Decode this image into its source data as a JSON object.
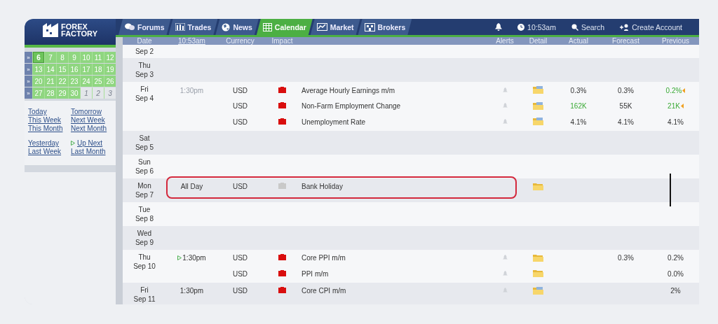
{
  "logo": {
    "line_1": "FOREX",
    "line_2": "FACTORY"
  },
  "nav": {
    "tabs": [
      {
        "label": "Forums",
        "selected": false
      },
      {
        "label": "Trades",
        "selected": false
      },
      {
        "label": "News",
        "selected": false
      },
      {
        "label": "Calendar",
        "selected": true
      },
      {
        "label": "Market",
        "selected": false
      },
      {
        "label": "Brokers",
        "selected": false
      }
    ],
    "time": "10:53am",
    "search": "Search",
    "create_account": "Create Account"
  },
  "mini_calendar": {
    "weeks": [
      [
        {
          "day": "6",
          "in_month": true,
          "selected": true
        },
        {
          "day": "7",
          "in_month": true,
          "selected": false
        },
        {
          "day": "8",
          "in_month": true,
          "selected": false
        },
        {
          "day": "9",
          "in_month": true,
          "selected": false
        },
        {
          "day": "10",
          "in_month": true,
          "selected": false
        },
        {
          "day": "11",
          "in_month": true,
          "selected": false
        },
        {
          "day": "12",
          "in_month": true,
          "selected": false
        }
      ],
      [
        {
          "day": "13",
          "in_month": true,
          "selected": false
        },
        {
          "day": "14",
          "in_month": true,
          "selected": false
        },
        {
          "day": "15",
          "in_month": true,
          "selected": false
        },
        {
          "day": "16",
          "in_month": true,
          "selected": false
        },
        {
          "day": "17",
          "in_month": true,
          "selected": false
        },
        {
          "day": "18",
          "in_month": true,
          "selected": false
        },
        {
          "day": "19",
          "in_month": true,
          "selected": false
        }
      ],
      [
        {
          "day": "20",
          "in_month": true,
          "selected": false
        },
        {
          "day": "21",
          "in_month": true,
          "selected": false
        },
        {
          "day": "22",
          "in_month": true,
          "selected": false
        },
        {
          "day": "23",
          "in_month": true,
          "selected": false
        },
        {
          "day": "24",
          "in_month": true,
          "selected": false
        },
        {
          "day": "25",
          "in_month": true,
          "selected": false
        },
        {
          "day": "26",
          "in_month": true,
          "selected": false
        }
      ],
      [
        {
          "day": "27",
          "in_month": true,
          "selected": false
        },
        {
          "day": "28",
          "in_month": true,
          "selected": false
        },
        {
          "day": "29",
          "in_month": true,
          "selected": false
        },
        {
          "day": "30",
          "in_month": true,
          "selected": false
        },
        {
          "day": "1",
          "in_month": false,
          "selected": false
        },
        {
          "day": "2",
          "in_month": false,
          "selected": false
        },
        {
          "day": "3",
          "in_month": false,
          "selected": false
        }
      ]
    ],
    "week_marker": "»"
  },
  "quick_links": [
    {
      "label": "Today",
      "marker": false
    },
    {
      "label": "Tomorrow",
      "marker": false
    },
    {
      "label": "This Week",
      "marker": false
    },
    {
      "label": "Next Week",
      "marker": false
    },
    {
      "label": "This Month",
      "marker": false
    },
    {
      "label": "Next Month",
      "marker": false
    },
    {
      "label": "Yesterday",
      "marker": false
    },
    {
      "label": "Up Next",
      "marker": true
    },
    {
      "label": "Last Week",
      "marker": false
    },
    {
      "label": "Last Month",
      "marker": false
    }
  ],
  "table": {
    "columns": [
      "Date",
      "10:53am",
      "Currency",
      "Impact",
      "Alerts",
      "Detail",
      "Actual",
      "Forecast",
      "Previous"
    ],
    "days": [
      {
        "date": "Sep 2"
      },
      {
        "weekday": "Thu",
        "date": "Sep 3"
      },
      {
        "weekday": "Fri",
        "date": "Sep 4",
        "events": [
          {
            "time": "1:30pm",
            "time_muted": true,
            "up_next": false,
            "currency": "USD",
            "high_impact": true,
            "title": "Average Hourly Earnings m/m",
            "alert": true,
            "detail_preview": true,
            "actual": "0.3%",
            "actual_better": false,
            "forecast": "0.3%",
            "previous": "0.2%",
            "previous_better": true,
            "revised": true,
            "highlighted": false
          },
          {
            "currency": "USD",
            "high_impact": true,
            "title": "Non-Farm Employment Change",
            "alert": true,
            "detail_preview": true,
            "actual": "162K",
            "actual_better": true,
            "forecast": "55K",
            "previous": "21K",
            "previous_better": true,
            "revised": true,
            "highlighted": false
          },
          {
            "currency": "USD",
            "high_impact": true,
            "title": "Unemployment Rate",
            "alert": true,
            "detail_preview": true,
            "actual": "4.1%",
            "actual_better": false,
            "forecast": "4.1%",
            "previous": "4.1%",
            "previous_better": false,
            "revised": false,
            "highlighted": false
          }
        ]
      },
      {
        "weekday": "Sat",
        "date": "Sep 5"
      },
      {
        "weekday": "Sun",
        "date": "Sep 6"
      },
      {
        "weekday": "Mon",
        "date": "Sep 7",
        "events": [
          {
            "time": "All Day",
            "time_muted": false,
            "up_next": false,
            "currency": "USD",
            "high_impact": false,
            "title": "Bank Holiday",
            "alert": false,
            "detail_preview": false,
            "revised": false,
            "highlighted": true
          }
        ]
      },
      {
        "weekday": "Tue",
        "date": "Sep 8"
      },
      {
        "weekday": "Wed",
        "date": "Sep 9"
      },
      {
        "weekday": "Thu",
        "date": "Sep 10",
        "events": [
          {
            "time": "1:30pm",
            "time_muted": false,
            "up_next": true,
            "currency": "USD",
            "high_impact": true,
            "title": "Core PPI m/m",
            "alert": true,
            "detail_preview": false,
            "forecast": "0.3%",
            "previous": "0.2%",
            "previous_better": false,
            "revised": false,
            "highlighted": false
          },
          {
            "currency": "USD",
            "high_impact": true,
            "title": "PPI m/m",
            "alert": true,
            "detail_preview": false,
            "previous": "0.0%",
            "previous_better": false,
            "revised": false,
            "highlighted": false
          }
        ]
      },
      {
        "weekday": "Fri",
        "date": "Sep 11",
        "events": [
          {
            "time": "1:30pm",
            "time_muted": false,
            "up_next": false,
            "currency": "USD",
            "high_impact": true,
            "title": "Core CPI m/m",
            "alert": true,
            "detail_preview": true,
            "previous": "2%",
            "previous_better": false,
            "revised": false,
            "highlighted": false
          }
        ]
      }
    ]
  }
}
